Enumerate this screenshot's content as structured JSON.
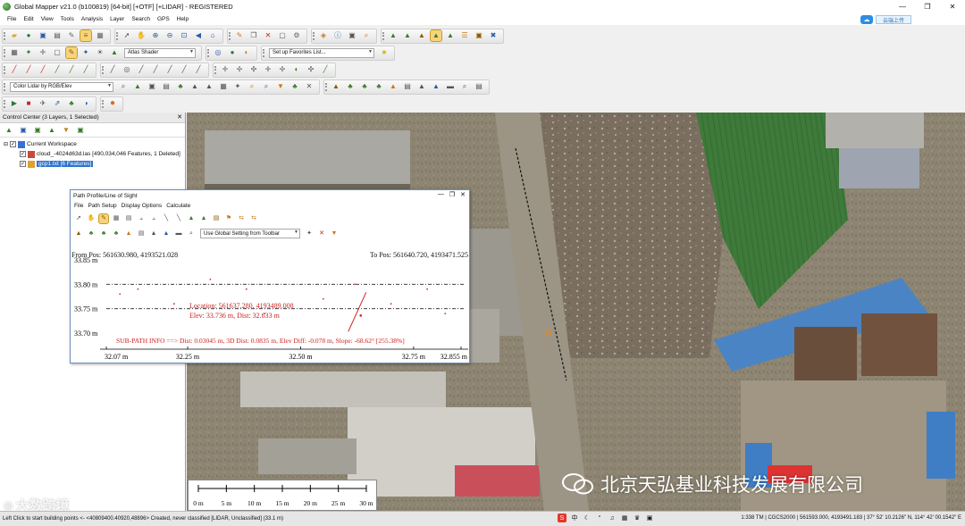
{
  "window": {
    "title": "Global Mapper v21.0 (b100819) [64-bit] [+OTF] [+LIDAR] - REGISTERED",
    "minimize": "—",
    "maximize": "❐",
    "close": "✕"
  },
  "menu": [
    "File",
    "Edit",
    "View",
    "Tools",
    "Analysis",
    "Layer",
    "Search",
    "GPS",
    "Help"
  ],
  "cloud_button": {
    "label": "云端上传"
  },
  "toolbars": {
    "shader_select": "Atlas Shader",
    "favorites_select": "Set up Favorites List...",
    "lidar_color_select": "Color Lidar by RGB/Elev"
  },
  "control_center": {
    "title": "Control Center (3 Layers, 1 Selected)",
    "close": "✕",
    "tree": [
      {
        "label": "Current Workspace",
        "checked": true,
        "indent": 0
      },
      {
        "label": "cloud_-4024d63d.las [490,034,046 Features, 1 Deleted]",
        "checked": true,
        "indent": 1
      },
      {
        "label": "gcp1.txt [6 Features]",
        "checked": true,
        "indent": 1,
        "selected": true
      }
    ]
  },
  "path_profile": {
    "title": "Path Profile/Line of Sight",
    "menu": [
      "File",
      "Path Setup",
      "Display Options",
      "Calculate"
    ],
    "global_setting": "Use Global Setting from Toolbar",
    "from_pos": "From Pos: 561630.980, 4193521.028",
    "to_pos": "To Pos: 561640.720, 4193471.525",
    "y_ticks": [
      "33.85 m",
      "33.80 m",
      "33.75 m",
      "33.70 m"
    ],
    "x_ticks": [
      "32.07 m",
      "32.25 m",
      "32.50 m",
      "32.75 m",
      "32.855 m"
    ],
    "location_label": "Location: 561637.280, 4193489.008",
    "elev_label": "Elev: 33.736 m, Dist: 32.633 m",
    "subpath_info": "SUB-PATH INFO ==> Dist: 0.03045 m, 3D Dist: 0.0835 m, Elev Diff: -0.078 m, Slope: -68.62° [255.38%]"
  },
  "chart_data": {
    "type": "scatter",
    "title": "",
    "xlabel": "",
    "ylabel": "",
    "xlim": [
      32.07,
      32.855
    ],
    "ylim": [
      33.7,
      33.85
    ],
    "x_ticks": [
      32.07,
      32.25,
      32.5,
      32.75,
      32.855
    ],
    "y_ticks": [
      33.85,
      33.8,
      33.75,
      33.7
    ],
    "series": [
      {
        "values": [
          [
            32.1,
            33.78
          ],
          [
            32.14,
            33.79
          ],
          [
            32.22,
            33.76
          ],
          [
            32.3,
            33.81
          ],
          [
            32.38,
            33.79
          ],
          [
            32.42,
            33.74
          ],
          [
            32.55,
            33.77
          ],
          [
            32.62,
            33.8
          ],
          [
            32.7,
            33.76
          ],
          [
            32.78,
            33.79
          ],
          [
            32.82,
            33.74
          ]
        ]
      }
    ],
    "selected_point": {
      "x": 32.633,
      "y": 33.736
    },
    "guide_lines_y": [
      33.8,
      33.75
    ]
  },
  "scale_bar": {
    "labels": [
      "0 m",
      "5 m",
      "10 m",
      "15 m",
      "20 m",
      "25 m",
      "30 m"
    ]
  },
  "status_bar": {
    "left": "Left Click to start building points <- <40809400.40920,48896> Created, never classified [LIDAR, Unclassified] (33.1 m)",
    "right": "1:338  TM | CGCS2000 | 561593.000, 4193491.183 | 37° 52' 10.2126\" N, 114° 42' 00.1542\" E"
  },
  "watermarks": {
    "left": "大数跨境",
    "right": "北京天弘基业科技发展有限公司"
  }
}
